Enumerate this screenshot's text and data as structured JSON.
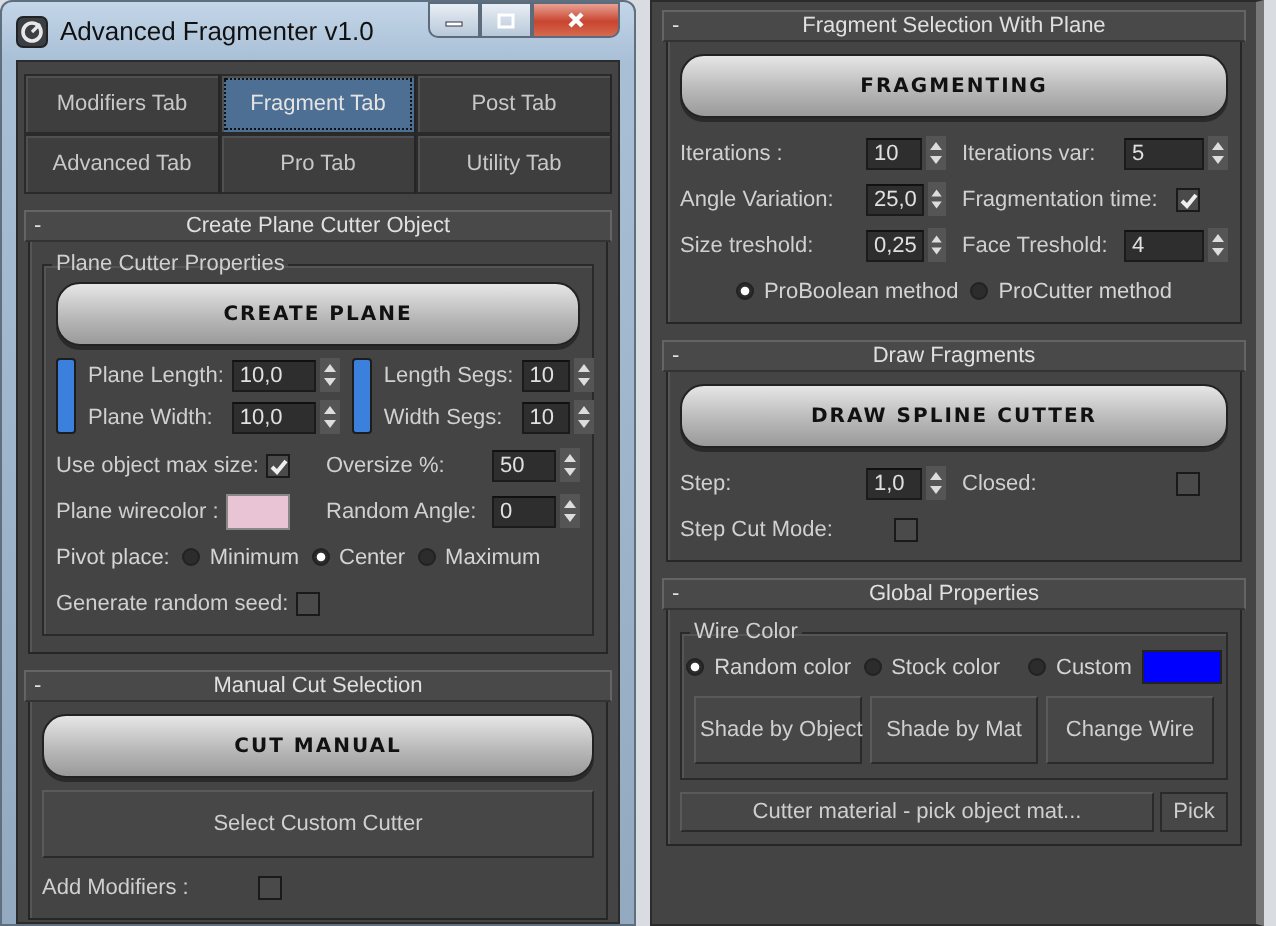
{
  "window": {
    "title": "Advanced Fragmenter v1.0"
  },
  "tabs": [
    {
      "label": "Modifiers Tab",
      "selected": false
    },
    {
      "label": "Fragment Tab",
      "selected": true
    },
    {
      "label": "Post Tab",
      "selected": false
    },
    {
      "label": "Advanced Tab",
      "selected": false
    },
    {
      "label": "Pro Tab",
      "selected": false
    },
    {
      "label": "Utility Tab",
      "selected": false
    }
  ],
  "left_rollouts": [
    {
      "toggle": "-",
      "title": "Create Plane Cutter Object",
      "rows": [
        {
          "kind": "group",
          "title": "Plane Cutter Properties",
          "rows": [
            {
              "kind": "big_button",
              "label": "CREATE PLANE"
            },
            {
              "kind": "dims",
              "blocks": [
                {
                  "color": "#3a80dc",
                  "fields": [
                    {
                      "label": "Plane Length:",
                      "value": "10,0"
                    },
                    {
                      "label": "Plane Width:",
                      "value": "10,0"
                    }
                  ]
                },
                {
                  "color": "#3a80dc",
                  "fields": [
                    {
                      "label": "Length Segs:",
                      "value": "10"
                    },
                    {
                      "label": "Width Segs:",
                      "value": "10"
                    }
                  ]
                }
              ]
            },
            {
              "kind": "pair",
              "items": [
                {
                  "kind": "checkbox",
                  "label": "Use object max size:",
                  "checked": true
                },
                {
                  "kind": "spinner",
                  "label": "Oversize %:",
                  "value": "50"
                }
              ]
            },
            {
              "kind": "pair",
              "items": [
                {
                  "kind": "swatch",
                  "label": "Plane wirecolor :",
                  "color": "#e8c4d4"
                },
                {
                  "kind": "spinner",
                  "label": "Random Angle:",
                  "value": "0"
                }
              ]
            },
            {
              "kind": "radios",
              "label": "Pivot place:",
              "options": [
                {
                  "label": "Minimum",
                  "selected": false
                },
                {
                  "label": "Center",
                  "selected": true
                },
                {
                  "label": "Maximum",
                  "selected": false
                }
              ]
            },
            {
              "kind": "pair",
              "items": [
                {
                  "kind": "checkbox",
                  "label": "Generate random seed:",
                  "checked": false
                }
              ]
            }
          ]
        }
      ]
    },
    {
      "toggle": "-",
      "title": "Manual Cut Selection",
      "rows": [
        {
          "kind": "big_button",
          "label": "CUT MANUAL"
        },
        {
          "kind": "buttons",
          "items": [
            "Select Custom Cutter"
          ]
        },
        {
          "kind": "pair",
          "items": [
            {
              "kind": "checkbox",
              "label": "Add Modifiers :",
              "checked": false
            }
          ]
        }
      ]
    }
  ],
  "right_rollouts": [
    {
      "toggle": "-",
      "title": "Fragment Selection With Plane",
      "rows": [
        {
          "kind": "big_button",
          "label": "FRAGMENTING"
        },
        {
          "kind": "pair",
          "items": [
            {
              "kind": "spinner",
              "label": "Iterations :",
              "value": "10"
            },
            {
              "kind": "spinner",
              "label": "Iterations var:",
              "value": "5"
            }
          ]
        },
        {
          "kind": "pair",
          "items": [
            {
              "kind": "spinner",
              "label": "Angle Variation:",
              "value": "25,0"
            },
            {
              "kind": "checkbox",
              "label": "Fragmentation time:",
              "checked": true
            }
          ]
        },
        {
          "kind": "pair",
          "items": [
            {
              "kind": "spinner",
              "label": "Size treshold:",
              "value": "0,25"
            },
            {
              "kind": "spinner",
              "label": "Face Treshold:",
              "value": "4"
            }
          ]
        },
        {
          "kind": "radios",
          "options": [
            {
              "label": "ProBoolean method",
              "selected": true
            },
            {
              "label": "ProCutter method",
              "selected": false
            }
          ]
        }
      ]
    },
    {
      "toggle": "-",
      "title": "Draw Fragments",
      "rows": [
        {
          "kind": "big_button",
          "label": "DRAW SPLINE CUTTER"
        },
        {
          "kind": "pair",
          "items": [
            {
              "kind": "spinner",
              "label": "Step:",
              "value": "1,0"
            },
            {
              "kind": "checkbox",
              "label": "Closed:",
              "checked": false
            }
          ]
        },
        {
          "kind": "pair",
          "items": [
            {
              "kind": "checkbox",
              "label": "Step Cut Mode:",
              "checked": false
            }
          ]
        }
      ]
    },
    {
      "toggle": "-",
      "title": "Global Properties",
      "rows": [
        {
          "kind": "group",
          "title": "Wire Color",
          "rows": [
            {
              "kind": "radios",
              "options": [
                {
                  "label": "Random color",
                  "selected": true
                },
                {
                  "label": "Stock color",
                  "selected": false
                },
                {
                  "label": "Custom",
                  "selected": false,
                  "color": "#0000ff"
                }
              ]
            },
            {
              "kind": "buttons",
              "items": [
                "Shade by Object",
                "Shade by Mat",
                "Change Wire"
              ]
            }
          ]
        },
        {
          "kind": "picker",
          "label": "Cutter material - pick object mat...",
          "button": "Pick"
        }
      ]
    }
  ]
}
